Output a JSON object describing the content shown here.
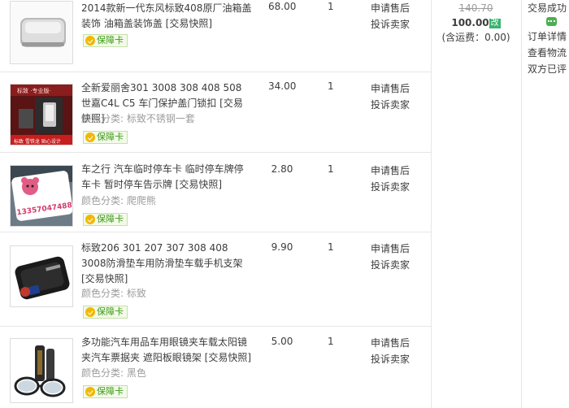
{
  "items": [
    {
      "title": "2014款新一代东风标致408原厂油箱盖装饰 油箱盖装饰盖",
      "snapshot": "[交易快照]",
      "sku": "",
      "badge": "保障卡",
      "price": "68.00",
      "qty": "1",
      "action1": "申请售后",
      "action2": "投诉卖家",
      "image_icon": "fuel-cap-product-image"
    },
    {
      "title": "全新爱丽舍301 3008 308 408 508 世嘉C4L C5 车门保护盖门锁扣",
      "snapshot": "[交易快照]",
      "sku": "颜色分类: 标致不锈钢一套",
      "badge": "保障卡",
      "price": "34.00",
      "qty": "1",
      "action1": "申请售后",
      "action2": "投诉卖家",
      "image_icon": "door-lock-cover-product-image",
      "image_text_top": "标致 ·专业版·",
      "image_text_bottom": "标致  雪铁龙  贴心设计"
    },
    {
      "title": "车之行 汽车临时停车卡 临时停车牌停车卡 暂时停车告示牌",
      "snapshot": "[交易快照]",
      "sku": "颜色分类: 爬爬熊",
      "badge": "保障卡",
      "price": "2.80",
      "qty": "1",
      "action1": "申请售后",
      "action2": "投诉卖家",
      "image_icon": "parking-card-product-image",
      "image_text": "13357047488"
    },
    {
      "title": "标致206 301 207 307 308 408 3008防滑垫车用防滑垫车载手机支架",
      "snapshot": "[交易快照]",
      "sku": "颜色分类: 标致",
      "badge": "保障卡",
      "price": "9.90",
      "qty": "1",
      "action1": "申请售后",
      "action2": "投诉卖家",
      "image_icon": "anti-slip-mat-product-image"
    },
    {
      "title": "多功能汽车用品车用眼镜夹车载太阳镜夹汽车票据夹 遮阳板眼镜架",
      "snapshot": "[交易快照]",
      "sku": "颜色分类: 黑色",
      "badge": "保障卡",
      "price": "5.00",
      "qty": "1",
      "action1": "申请售后",
      "action2": "投诉卖家",
      "image_icon": "glasses-clip-product-image"
    }
  ],
  "order": {
    "original_total": "140.70",
    "paid_total": "100.00",
    "modified_tag": "改",
    "shipping": "(含运费：0.00)"
  },
  "status": {
    "state": "交易成功",
    "chat_icon": "wangwang-chat-icon",
    "detail": "订单详情",
    "logistics": "查看物流",
    "rated": "双方已评"
  },
  "colors": {
    "border": "#e6e6e6",
    "muted": "#9c9c9c",
    "badge_green": "#3d9b18",
    "modified_green": "#3cb371"
  }
}
